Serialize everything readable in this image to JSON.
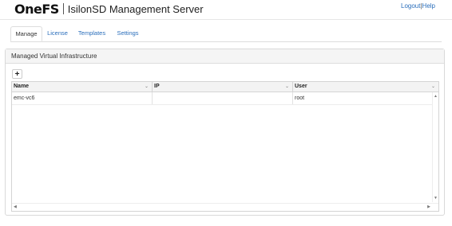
{
  "header": {
    "logo_text": "OneFS",
    "app_title": "IsilonSD Management Server",
    "links": {
      "logout": "Logout",
      "separator": "|",
      "help": "Help"
    }
  },
  "tabs": [
    {
      "label": "Manage",
      "active": true
    },
    {
      "label": "License",
      "active": false
    },
    {
      "label": "Templates",
      "active": false
    },
    {
      "label": "Settings",
      "active": false
    }
  ],
  "panel": {
    "title": "Managed Virtual Infrastructure",
    "add_label": "+"
  },
  "grid": {
    "columns": [
      "Name",
      "IP",
      "User"
    ],
    "rows": [
      {
        "name": "emc-vc6",
        "ip": "",
        "user": "root"
      }
    ]
  },
  "colors": {
    "link": "#2a6ebb",
    "panel_heading_bg": "#f5f5f5"
  }
}
